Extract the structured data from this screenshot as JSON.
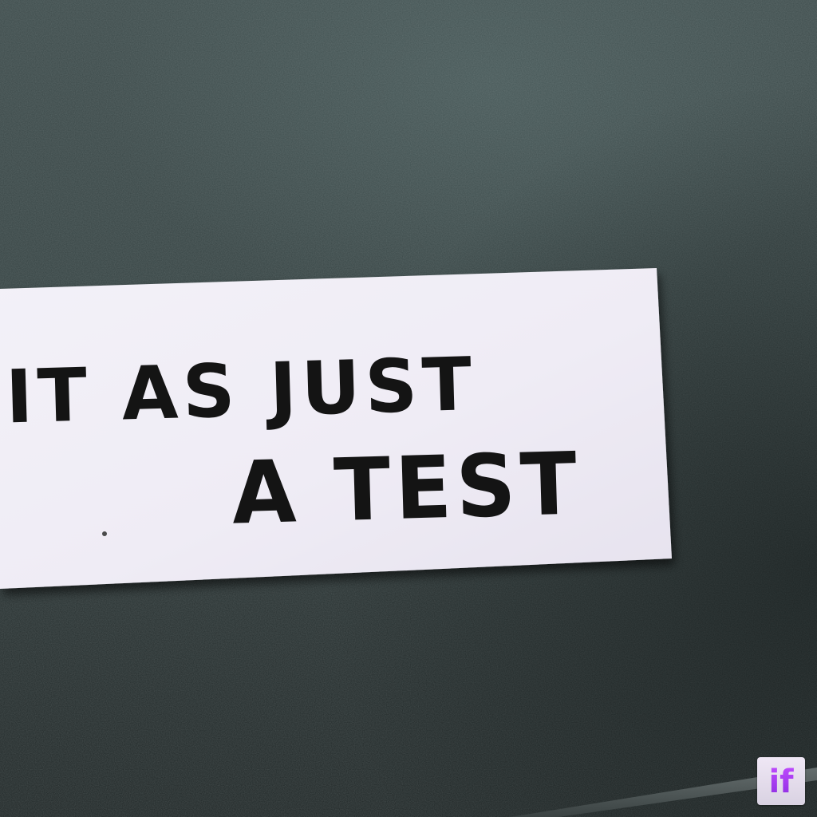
{
  "photo": {
    "subject": "handwritten note card",
    "background_color": "#2f3a3a",
    "paper_color": "#f1eef6",
    "ink_color": "#141414"
  },
  "note": {
    "line1": "IT AS JUST",
    "line2": "A TEST"
  },
  "watermark": {
    "text": "if",
    "icon": "if-logo-icon",
    "accent": "#b43cf0"
  }
}
